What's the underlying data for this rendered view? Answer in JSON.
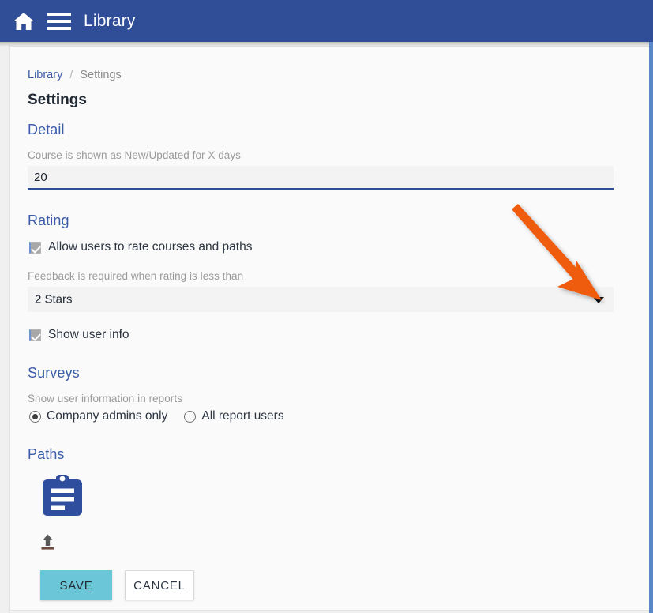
{
  "topbar": {
    "home_icon": "home-icon",
    "menu_icon": "hamburger-menu-icon",
    "title": "Library"
  },
  "breadcrumb": {
    "parent": "Library",
    "separator": "/",
    "current": "Settings"
  },
  "page": {
    "title": "Settings"
  },
  "sections": {
    "detail": {
      "heading": "Detail",
      "field_label": "Course is shown as New/Updated for X days",
      "field_value": "20",
      "field_placeholder": ""
    },
    "rating": {
      "heading": "Rating",
      "allow_rate_label": "Allow users to rate courses and paths",
      "allow_rate_checked": "checked",
      "feedback_label": "Feedback is required when rating is less than",
      "feedback_value": "2 Stars",
      "feedback_options": [
        "2 Stars"
      ],
      "show_user_info_label": "Show user info",
      "show_user_info_checked": "checked"
    },
    "surveys": {
      "heading": "Surveys",
      "report_label": "Show user information in reports",
      "options": [
        {
          "label": "Company admins only",
          "selected": true
        },
        {
          "label": "All report users",
          "selected": false
        }
      ]
    },
    "paths": {
      "heading": "Paths",
      "tile_icon": "clipboard-icon",
      "upload_icon": "upload-icon"
    }
  },
  "actions": {
    "save_label": "SAVE",
    "cancel_label": "CANCEL"
  },
  "colors": {
    "topbar_blue": "#304d97",
    "link_blue": "#3b5ca8",
    "save_teal": "#6bc7d8",
    "annotation_orange": "#ef5b0c",
    "scroll_strip": "#5b86c8"
  },
  "annotation": {
    "type": "arrow",
    "points_to": "feedback-rating-dropdown-caret",
    "color": "#ef5b0c"
  }
}
